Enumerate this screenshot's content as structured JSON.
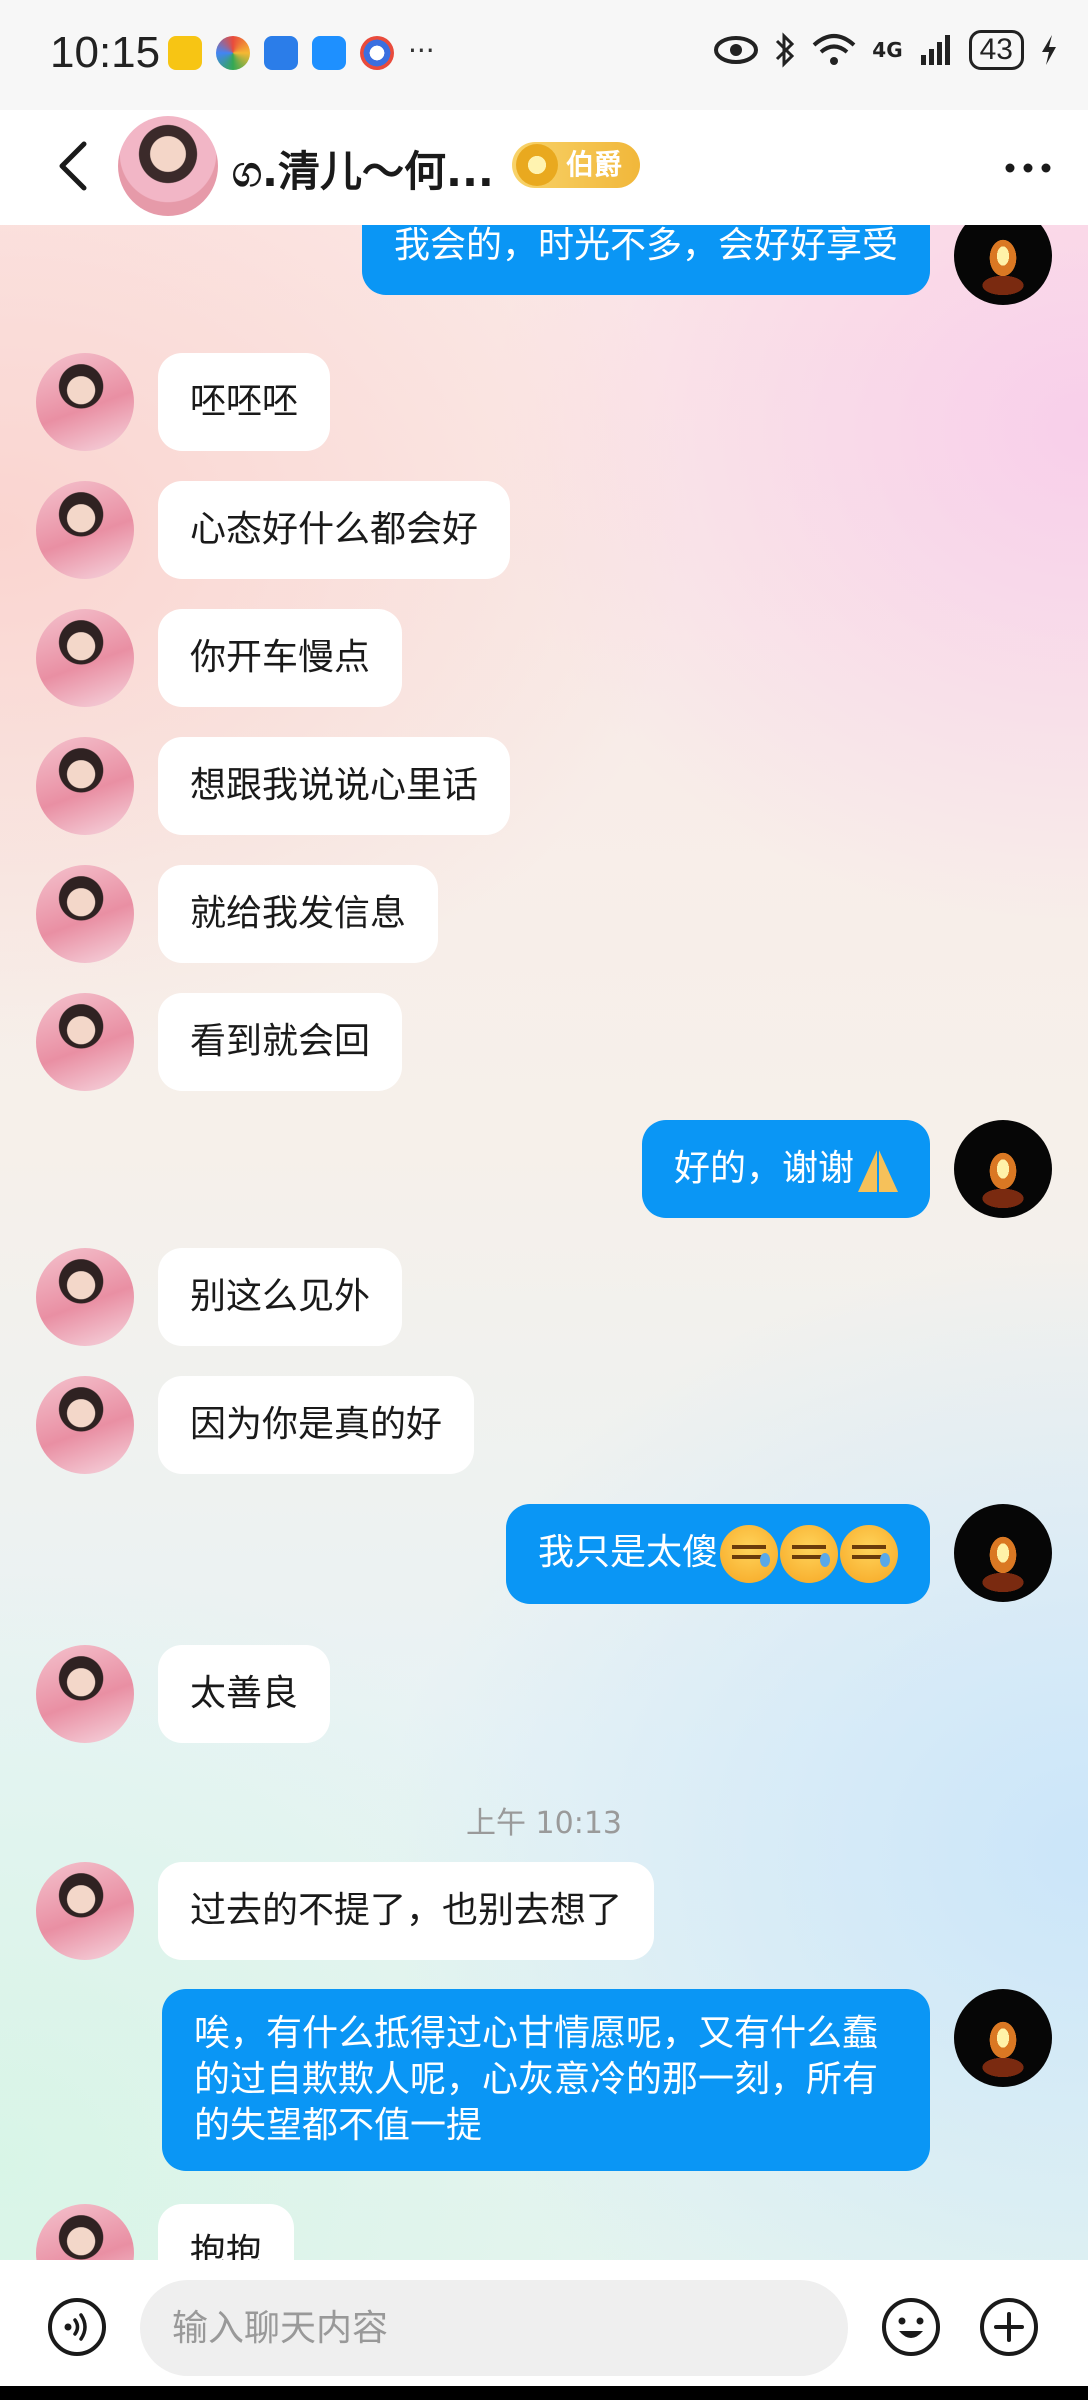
{
  "status_bar": {
    "time": "10:15",
    "network": "4G",
    "battery": "43"
  },
  "header": {
    "contact_name": "ග.清儿～何...",
    "badge": "伯爵"
  },
  "messages": [
    {
      "side": "right",
      "text": "我会的，时光不多，会好好享受"
    },
    {
      "side": "left",
      "text": "呸呸呸"
    },
    {
      "side": "left",
      "text": "心态好什么都会好"
    },
    {
      "side": "left",
      "text": "你开车慢点"
    },
    {
      "side": "left",
      "text": "想跟我说说心里话"
    },
    {
      "side": "left",
      "text": "就给我发信息"
    },
    {
      "side": "left",
      "text": "看到就会回"
    },
    {
      "side": "right",
      "text": "好的，谢谢"
    },
    {
      "side": "left",
      "text": "别这么见外"
    },
    {
      "side": "left",
      "text": "因为你是真的好"
    },
    {
      "side": "right",
      "text": "我只是太傻"
    },
    {
      "side": "left",
      "text": "太善良"
    },
    {
      "side": "timestamp",
      "text": "上午 10:13"
    },
    {
      "side": "left",
      "text": "过去的不提了，也别去想了"
    },
    {
      "side": "right",
      "text": "唉，有什么抵得过心甘情愿呢，又有什么蠢的过自欺欺人呢，心灰意冷的那一刻，所有的失望都不值一提"
    },
    {
      "side": "left",
      "text": "抱抱"
    }
  ],
  "input": {
    "placeholder": "输入聊天内容"
  },
  "colors": {
    "sent_bubble": "#0a96f5",
    "received_bubble": "#ffffff",
    "badge": "#f1b73a"
  },
  "icons": [
    "back-icon",
    "more-icon",
    "voice-icon",
    "emoji-icon",
    "plus-icon",
    "pray-emoji",
    "sleepy-emoji"
  ]
}
